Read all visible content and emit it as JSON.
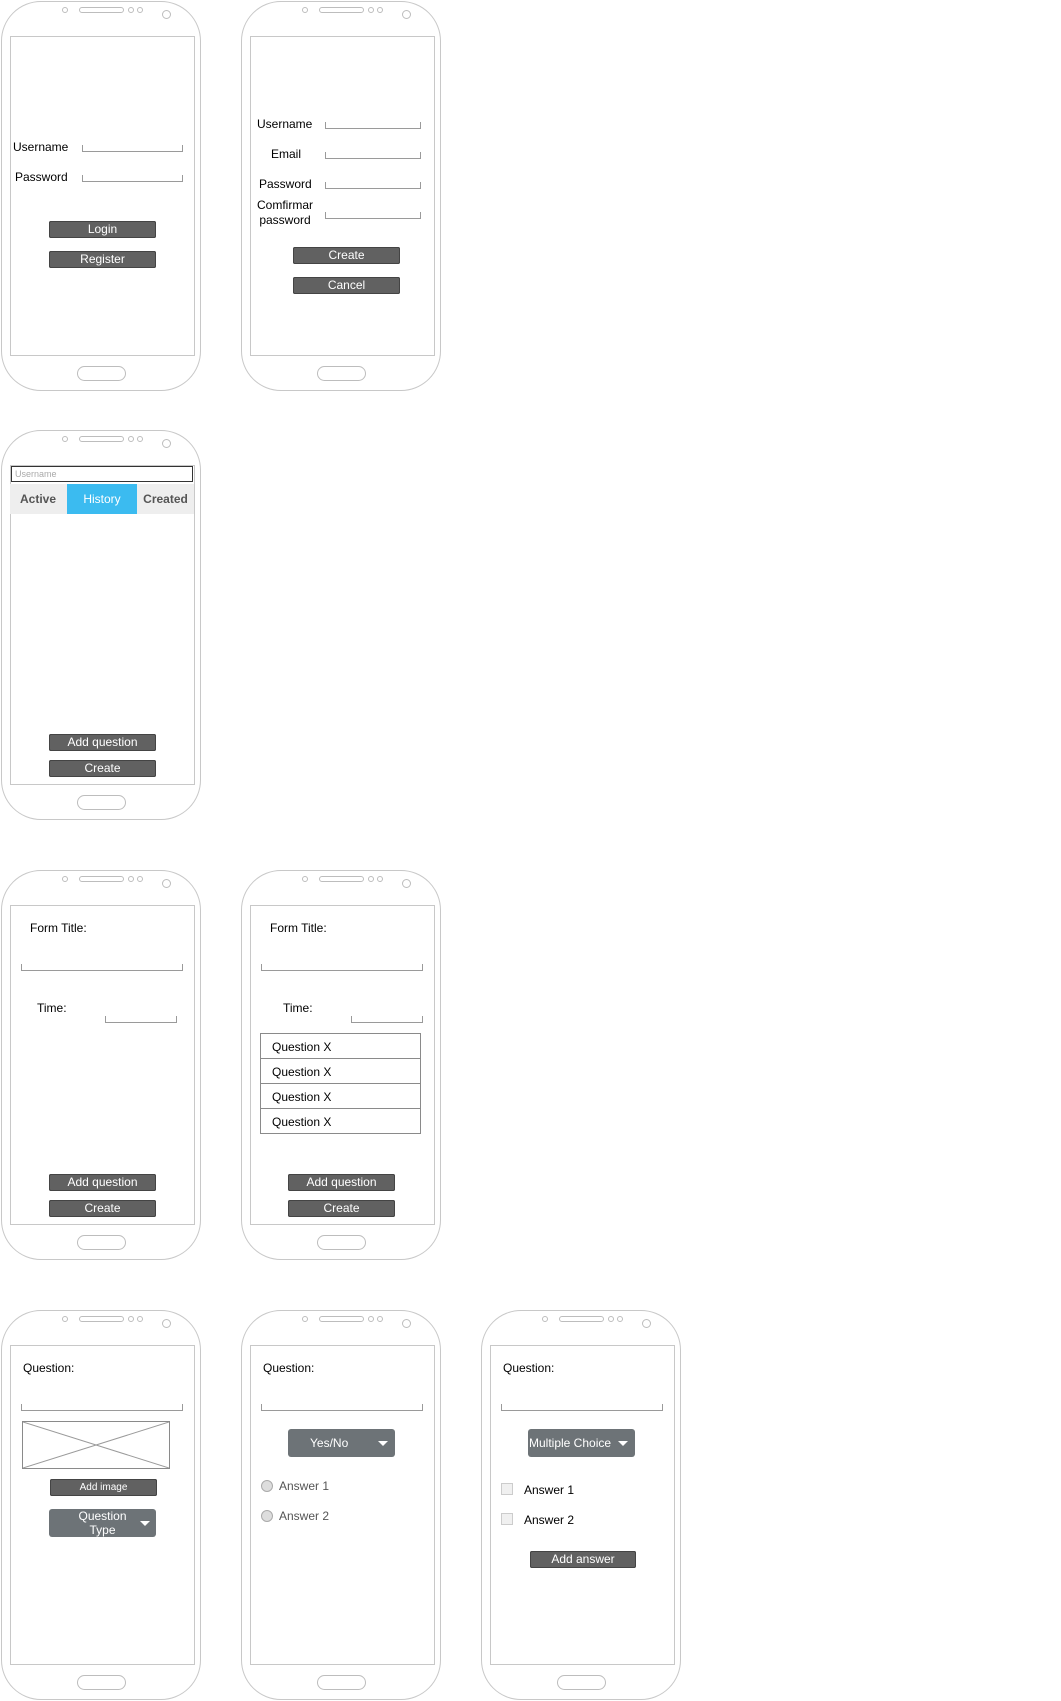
{
  "login": {
    "username_label": "Username",
    "password_label": "Password",
    "login_button": "Login",
    "register_button": "Register"
  },
  "register": {
    "username_label": "Username",
    "email_label": "Email",
    "password_label": "Password",
    "confirm_label_line1": "Comfirmar",
    "confirm_label_line2": "password",
    "create_button": "Create",
    "cancel_button": "Cancel"
  },
  "dashboard": {
    "search_placeholder": "Username",
    "tabs": [
      {
        "label": "Active",
        "selected": false
      },
      {
        "label": "History",
        "selected": true
      },
      {
        "label": "Created",
        "selected": false
      }
    ],
    "add_question_button": "Add question",
    "create_button": "Create",
    "accent_color": "#3bbbf0"
  },
  "form_empty": {
    "form_title_label": "Form Title:",
    "time_label": "Time:",
    "add_question_button": "Add question",
    "create_button": "Create"
  },
  "form_filled": {
    "form_title_label": "Form Title:",
    "time_label": "Time:",
    "questions": [
      "Question X",
      "Question X",
      "Question X",
      "Question X"
    ],
    "add_question_button": "Add question",
    "create_button": "Create"
  },
  "question_base": {
    "question_label": "Question:",
    "add_image_button": "Add image",
    "type_select_line1": "Question",
    "type_select_line2": "Type"
  },
  "question_yesno": {
    "question_label": "Question:",
    "type_select": "Yes/No",
    "answers": [
      "Answer 1",
      "Answer 2"
    ]
  },
  "question_multiple": {
    "question_label": "Question:",
    "type_select": "Multiple Choice",
    "answers": [
      "Answer 1",
      "Answer 2"
    ],
    "add_answer_button": "Add answer"
  }
}
